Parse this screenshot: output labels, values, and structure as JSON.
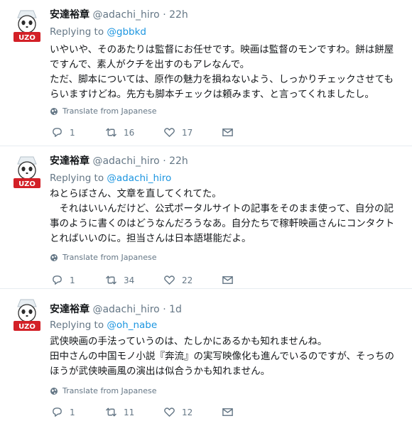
{
  "tweets": [
    {
      "name": "安達裕章",
      "handle": "@adachi_hiro",
      "dot": "·",
      "time": "22h",
      "replying_to_label": "Replying to",
      "replying_to_mention": "@gbbkd",
      "text_lines": [
        "いやいや、そのあたりは監督にお任せです。映画は監督のモンですわ。餅は餅屋",
        "ですんで、素人がクチを出すのもアレなんで。",
        "ただ、脚本については、原作の魅力を損ねないよう、しっかりチェックさせても",
        "らいますけどね。先方も脚本チェックは頼みます、と言ってくれましたし。"
      ],
      "translate_label": "Translate from Japanese",
      "replies": "1",
      "retweets": "16",
      "likes": "17"
    },
    {
      "name": "安達裕章",
      "handle": "@adachi_hiro",
      "dot": "·",
      "time": "22h",
      "replying_to_label": "Replying to",
      "replying_to_mention": "@adachi_hiro",
      "text_lines": [
        "ねとらぼさん、文章を直してくれてた。",
        "　それはいいんだけど、公式ポータルサイトの記事をそのまま使って、自分の記",
        "事のように書くのはどうなんだろうなあ。自分たちで稼軒映画さんにコンタクト",
        "とればいいのに。担当さんは日本語堪能だよ。"
      ],
      "translate_label": "Translate from Japanese",
      "replies": "1",
      "retweets": "34",
      "likes": "22"
    },
    {
      "name": "安達裕章",
      "handle": "@adachi_hiro",
      "dot": "·",
      "time": "1d",
      "replying_to_label": "Replying to",
      "replying_to_mention": "@oh_nabe",
      "text_lines": [
        "武侠映画の手法っていうのは、たしかにあるかも知れませんね。",
        "田中さんの中国モノ小説『奔流』の実写映像化も進んでいるのですが、そっちの",
        "ほうが武侠映画風の演出は似合うかも知れません。"
      ],
      "translate_label": "Translate from Japanese",
      "replies": "1",
      "retweets": "11",
      "likes": "12"
    }
  ],
  "icons": {
    "reply": "reply-icon",
    "retweet": "retweet-icon",
    "like": "heart-icon",
    "dm": "envelope-icon",
    "translate": "globe-icon"
  },
  "colors": {
    "link": "#1b95e0",
    "secondary_text": "#657786",
    "primary_text": "#14171a",
    "divider": "#e6ecf0"
  }
}
